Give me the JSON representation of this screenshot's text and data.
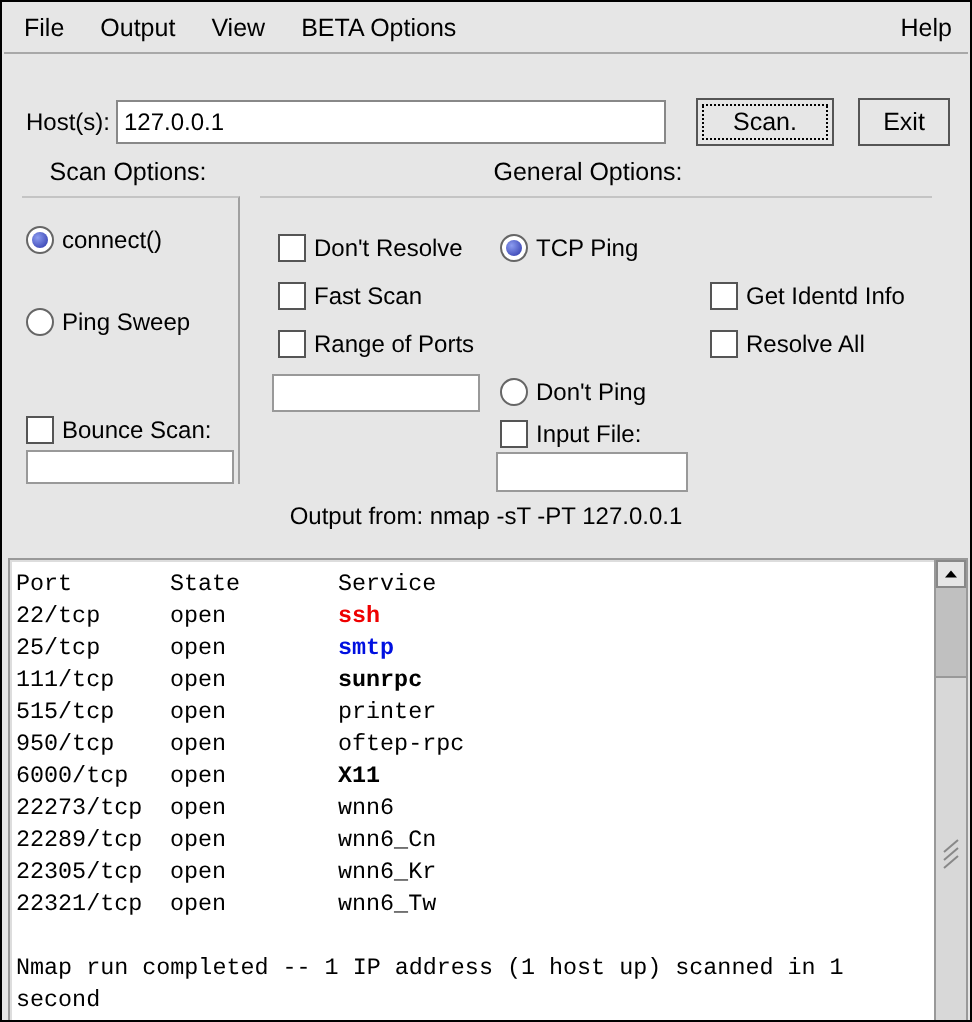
{
  "menu": {
    "items": [
      {
        "label": "File"
      },
      {
        "label": "Output"
      },
      {
        "label": "View"
      },
      {
        "label": "BETA Options"
      }
    ],
    "help": "Help"
  },
  "host": {
    "label": "Host(s):",
    "value": "127.0.0.1"
  },
  "buttons": [
    {
      "label": "Scan.",
      "focused": true
    },
    {
      "label": "Exit",
      "focused": false
    }
  ],
  "scan_options": {
    "title": "Scan Options:",
    "items": [
      {
        "kind": "radio",
        "label": "connect()",
        "selected": true
      },
      {
        "kind": "radio",
        "label": "Ping Sweep",
        "selected": false
      },
      {
        "kind": "checkbox",
        "label": "Bounce Scan:",
        "checked": false
      },
      {
        "kind": "field"
      }
    ]
  },
  "general_options": {
    "title": "General Options:",
    "items": [
      {
        "kind": "checkbox",
        "label": "Don't Resolve",
        "checked": false
      },
      {
        "kind": "radio",
        "label": "TCP Ping",
        "selected": true
      },
      {
        "kind": "checkbox",
        "label": "Fast Scan",
        "checked": false
      },
      {
        "kind": "checkbox",
        "label": "Get Identd Info",
        "checked": false
      },
      {
        "kind": "checkbox",
        "label": "Range of Ports",
        "checked": false
      },
      {
        "kind": "checkbox",
        "label": "Resolve All",
        "checked": false
      },
      {
        "kind": "field"
      },
      {
        "kind": "radio",
        "label": "Don't Ping",
        "selected": false
      },
      {
        "kind": "checkbox",
        "label": "Input File:",
        "checked": false
      },
      {
        "kind": "field"
      }
    ]
  },
  "command": "Output from: nmap -sT -PT 127.0.0.1",
  "output": {
    "header": [
      "Port",
      "State",
      "Service"
    ],
    "rows": [
      {
        "port": "22/tcp",
        "state": "open",
        "service": "ssh",
        "kind": "alert"
      },
      {
        "port": "25/tcp",
        "state": "open",
        "service": "smtp",
        "kind": "notice"
      },
      {
        "port": "111/tcp",
        "state": "open",
        "service": "sunrpc",
        "kind": "bold"
      },
      {
        "port": "515/tcp",
        "state": "open",
        "service": "printer",
        "kind": "plain"
      },
      {
        "port": "950/tcp",
        "state": "open",
        "service": "oftep-rpc",
        "kind": "plain"
      },
      {
        "port": "6000/tcp",
        "state": "open",
        "service": "X11",
        "kind": "bold"
      },
      {
        "port": "22273/tcp",
        "state": "open",
        "service": "wnn6",
        "kind": "plain"
      },
      {
        "port": "22289/tcp",
        "state": "open",
        "service": "wnn6_Cn",
        "kind": "plain"
      },
      {
        "port": "22305/tcp",
        "state": "open",
        "service": "wnn6_Kr",
        "kind": "plain"
      },
      {
        "port": "22321/tcp",
        "state": "open",
        "service": "wnn6_Tw",
        "kind": "plain"
      }
    ],
    "summary": "Nmap run completed -- 1 IP address (1 host up) scanned in 1 second"
  }
}
